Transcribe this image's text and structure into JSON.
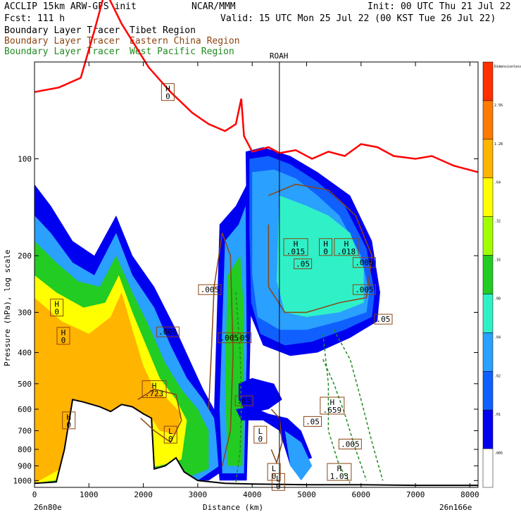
{
  "header": {
    "left1": "ACCLIP 15km ARW-GFS init",
    "center": "NCAR/MMM",
    "right1": "Init: 00 UTC Thu 21 Jul 22",
    "left2": "Fcst:  111 h",
    "right2": "Valid: 15 UTC Mon 25 Jul 22 (00 KST Tue 26 Jul 22)"
  },
  "legend": [
    {
      "prefix": "Boundary Layer Tracer",
      "region": "Tibet Region",
      "color": "#000000"
    },
    {
      "prefix": "Boundary Layer Tracer",
      "region": "Eastern China Region",
      "color": "#8B4513"
    },
    {
      "prefix": "Boundary Layer Tracer",
      "region": "West Pacific Region",
      "color": "#228B22"
    }
  ],
  "station_label": "ROAH",
  "colorbar": {
    "labels": [
      "Dimensionless",
      "2.56",
      "1.28",
      ".64",
      ".32",
      ".16",
      ".08",
      ".04",
      ".02",
      ".01",
      ".005"
    ],
    "colors": [
      "#ff3000",
      "#ff7a00",
      "#ffb400",
      "#ffff00",
      "#a0ff00",
      "#22cc22",
      "#30f0c8",
      "#2aa0ff",
      "#1060ff",
      "#0000f0",
      "#ffffff"
    ]
  },
  "chart_data": {
    "type": "cross-section",
    "xlabel": "Distance (km)",
    "ylabel": "Pressure (hPa), log scale",
    "x_ticks": [
      "0",
      "1000",
      "2000",
      "3000",
      "4000",
      "5000",
      "6000",
      "7000",
      "8000"
    ],
    "y_ticks": [
      "100",
      "200",
      "300",
      "400",
      "500",
      "600",
      "700",
      "800",
      "900",
      "1000"
    ],
    "xlim": [
      0,
      8150
    ],
    "ylim_hpa": [
      1050,
      50
    ],
    "left_endpoint": "26n80e",
    "right_endpoint": "26n166e",
    "station_x_km": 4500,
    "tropopause_line": {
      "color": "#ff0000",
      "points": [
        [
          0,
          62
        ],
        [
          450,
          60
        ],
        [
          850,
          56
        ],
        [
          1100,
          40
        ],
        [
          1300,
          30
        ],
        [
          1600,
          38
        ],
        [
          2100,
          52
        ],
        [
          2500,
          62
        ],
        [
          2900,
          72
        ],
        [
          3200,
          78
        ],
        [
          3500,
          82
        ],
        [
          3700,
          78
        ],
        [
          3800,
          65
        ],
        [
          3850,
          85
        ],
        [
          4000,
          95
        ],
        [
          4300,
          92
        ],
        [
          4500,
          96
        ],
        [
          4800,
          94
        ],
        [
          5100,
          100
        ],
        [
          5400,
          95
        ],
        [
          5700,
          98
        ],
        [
          6000,
          90
        ],
        [
          6300,
          92
        ],
        [
          6600,
          98
        ],
        [
          7000,
          100
        ],
        [
          7300,
          98
        ],
        [
          7700,
          105
        ],
        [
          8150,
          110
        ]
      ]
    },
    "terrain_hpa": [
      [
        0,
        1020
      ],
      [
        400,
        1010
      ],
      [
        550,
        800
      ],
      [
        700,
        560
      ],
      [
        900,
        570
      ],
      [
        1200,
        590
      ],
      [
        1400,
        610
      ],
      [
        1600,
        580
      ],
      [
        1800,
        590
      ],
      [
        2000,
        620
      ],
      [
        2150,
        640
      ],
      [
        2200,
        920
      ],
      [
        2400,
        900
      ],
      [
        2600,
        850
      ],
      [
        2750,
        940
      ],
      [
        3000,
        1000
      ],
      [
        3500,
        1020
      ],
      [
        4000,
        1025
      ],
      [
        5000,
        1030
      ],
      [
        6000,
        1030
      ],
      [
        7000,
        1035
      ],
      [
        8150,
        1035
      ]
    ],
    "labels_max_min": [
      {
        "kind": "H",
        "value": "0",
        "x": 410,
        "p": 290
      },
      {
        "kind": "H",
        "value": "0",
        "x": 530,
        "p": 355
      },
      {
        "kind": "H",
        "value": "0",
        "x": 630,
        "p": 650
      },
      {
        "kind": "H",
        "value": "0",
        "x": 2450,
        "p": 62
      },
      {
        "kind": "H",
        "value": ".723",
        "x": 2200,
        "p": 520
      },
      {
        "kind": "H",
        "value": ".015",
        "x": 4800,
        "p": 188
      },
      {
        "kind": "H",
        "value": "0",
        "x": 5350,
        "p": 188
      },
      {
        "kind": "H",
        "value": ".018",
        "x": 5730,
        "p": 188
      },
      {
        "kind": "H",
        "value": ".659",
        "x": 5470,
        "p": 585
      },
      {
        "kind": "H",
        "value": "1.03",
        "x": 5600,
        "p": 940
      },
      {
        "kind": "L",
        "value": "0",
        "x": 2500,
        "p": 720
      },
      {
        "kind": "L",
        "value": "0",
        "x": 4150,
        "p": 720
      },
      {
        "kind": "L",
        "value": "0",
        "x": 4400,
        "p": 940
      },
      {
        "kind": "L",
        "value": "0",
        "x": 4480,
        "p": 1010
      }
    ],
    "contour_labels": [
      {
        "value": ".005",
        "x": 2450,
        "p": 345
      },
      {
        "value": ".005",
        "x": 3220,
        "p": 255
      },
      {
        "value": ".005",
        "x": 3580,
        "p": 360
      },
      {
        "value": ".05",
        "x": 3820,
        "p": 360
      },
      {
        "value": ".05",
        "x": 3850,
        "p": 565
      },
      {
        "value": ".05",
        "x": 4930,
        "p": 212
      },
      {
        "value": ".005",
        "x": 6060,
        "p": 210
      },
      {
        "value": ".005",
        "x": 6060,
        "p": 255
      },
      {
        "value": ".05",
        "x": 6410,
        "p": 315
      },
      {
        "value": ".05",
        "x": 5110,
        "p": 655
      },
      {
        "value": ".005",
        "x": 5800,
        "p": 770
      }
    ]
  }
}
